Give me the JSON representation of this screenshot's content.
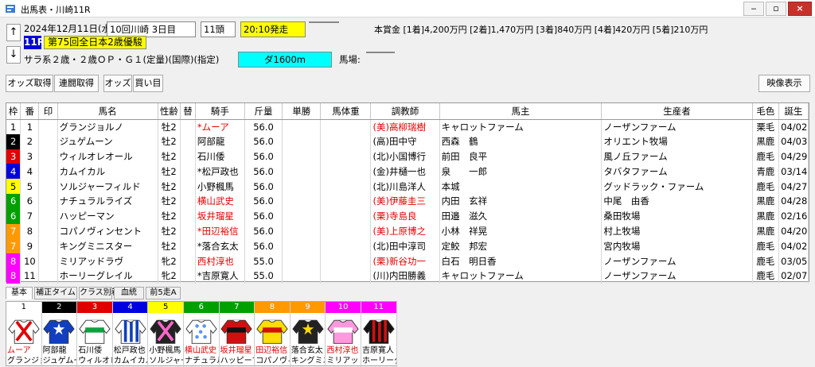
{
  "window": {
    "title": "出馬表・川崎11R"
  },
  "header": {
    "date": "2024年12月11日(水)",
    "meeting": "10回川崎 3日目",
    "runners": "11頭",
    "post_time": "20:10発走",
    "race_no": "11R",
    "race_name": "第75回全日本2歳優駿",
    "conditions": "サラ系２歳・２歳ＯＰ・Ｇ１(定量)(国際)(指定)",
    "distance": "ダ1600m",
    "track_label": "馬場:",
    "prize": "本賞金 [1着]4,200万円 [2着]1,470万円 [3着]840万円 [4着]420万円 [5着]210万円"
  },
  "toolbar": {
    "odds": "オッズ取得",
    "renpuku": "連闘取得",
    "odds2": "オッズ",
    "buy": "買い目",
    "video": "映像表示"
  },
  "table": {
    "columns": [
      "枠",
      "番",
      "印",
      "馬名",
      "性齢",
      "替",
      "騎手",
      "斤量",
      "単勝",
      "馬体重",
      "調教師",
      "馬主",
      "生産者",
      "毛色",
      "誕生"
    ],
    "rows": [
      {
        "waku": "1",
        "ban": "1",
        "name": "グランジョルノ",
        "sex": "牡2",
        "change": "",
        "jockey": "*ムーア",
        "jockey_red": true,
        "weight": "56.0",
        "trainer": "(美)高柳瑞樹",
        "trainer_red": true,
        "owner": "キャロットファーム",
        "breeder": "ノーザンファーム",
        "color": "栗毛",
        "birth": "04/02"
      },
      {
        "waku": "2",
        "ban": "2",
        "name": "ジュゲムーン",
        "sex": "牡2",
        "change": "",
        "jockey": "阿部龍",
        "jockey_red": false,
        "weight": "56.0",
        "trainer": "(高)田中守",
        "trainer_red": false,
        "owner": "西森　鶴",
        "breeder": "オリエント牧場",
        "color": "黒鹿",
        "birth": "04/03"
      },
      {
        "waku": "3",
        "ban": "3",
        "name": "ウィルオレオール",
        "sex": "牡2",
        "change": "",
        "jockey": "石川倭",
        "jockey_red": false,
        "weight": "56.0",
        "trainer": "(北)小国博行",
        "trainer_red": false,
        "owner": "前田　良平",
        "breeder": "風ノ丘ファーム",
        "color": "鹿毛",
        "birth": "04/29"
      },
      {
        "waku": "4",
        "ban": "4",
        "name": "カムイカル",
        "sex": "牡2",
        "change": "",
        "jockey": "*松戸政也",
        "jockey_red": false,
        "weight": "56.0",
        "trainer": "(金)井樋一也",
        "trainer_red": false,
        "owner": "泉　　一郎",
        "breeder": "タバタファーム",
        "color": "青鹿",
        "birth": "03/14"
      },
      {
        "waku": "5",
        "ban": "5",
        "name": "ソルジャーフィルド",
        "sex": "牡2",
        "change": "",
        "jockey": "小野楓馬",
        "jockey_red": false,
        "weight": "56.0",
        "trainer": "(北)川島洋人",
        "trainer_red": false,
        "owner": "本城",
        "breeder": "グッドラック・ファーム",
        "color": "鹿毛",
        "birth": "04/27"
      },
      {
        "waku": "6",
        "ban": "6",
        "name": "ナチュラルライズ",
        "sex": "牡2",
        "change": "",
        "jockey": "横山武史",
        "jockey_red": true,
        "weight": "56.0",
        "trainer": "(美)伊藤圭三",
        "trainer_red": true,
        "owner": "内田　玄祥",
        "breeder": "中尾　由香",
        "color": "黒鹿",
        "birth": "04/28"
      },
      {
        "waku": "6",
        "ban": "7",
        "name": "ハッピーマン",
        "sex": "牡2",
        "change": "",
        "jockey": "坂井瑠星",
        "jockey_red": true,
        "weight": "56.0",
        "trainer": "(栗)寺島良",
        "trainer_red": true,
        "owner": "田邉　滋久",
        "breeder": "桑田牧場",
        "color": "黒鹿",
        "birth": "02/16"
      },
      {
        "waku": "7",
        "ban": "8",
        "name": "コパノヴィンセント",
        "sex": "牡2",
        "change": "",
        "jockey": "*田辺裕信",
        "jockey_red": true,
        "weight": "56.0",
        "trainer": "(美)上原博之",
        "trainer_red": true,
        "owner": "小林　祥晃",
        "breeder": "村上牧場",
        "color": "黒鹿",
        "birth": "04/20"
      },
      {
        "waku": "7",
        "ban": "9",
        "name": "キングミニスター",
        "sex": "牡2",
        "change": "",
        "jockey": "*落合玄太",
        "jockey_red": false,
        "weight": "56.0",
        "trainer": "(北)田中淳司",
        "trainer_red": false,
        "owner": "定鮫　邦宏",
        "breeder": "宮内牧場",
        "color": "鹿毛",
        "birth": "04/02"
      },
      {
        "waku": "8",
        "ban": "10",
        "name": "ミリアッドラヴ",
        "sex": "牝2",
        "change": "",
        "jockey": "西村淳也",
        "jockey_red": true,
        "weight": "55.0",
        "trainer": "(栗)新谷功一",
        "trainer_red": true,
        "owner": "白石　明日香",
        "breeder": "ノーザンファーム",
        "color": "鹿毛",
        "birth": "03/05"
      },
      {
        "waku": "8",
        "ban": "11",
        "name": "ホーリーグレイル",
        "sex": "牝2",
        "change": "",
        "jockey": "*吉原寛人",
        "jockey_red": false,
        "weight": "55.0",
        "trainer": "(川)内田勝義",
        "trainer_red": false,
        "owner": "キャロットファーム",
        "breeder": "ノーザンファーム",
        "color": "鹿毛",
        "birth": "02/07"
      }
    ]
  },
  "tabs": [
    "基本",
    "補正タイム",
    "クラス別着",
    "血統",
    "前5走A"
  ],
  "silks": [
    {
      "num": "1",
      "jockey": "ムーア",
      "jockey_red": true,
      "horse": "グランジョルノ",
      "icon": "silk-red-white-x",
      "hdr_bg": "#ffffff",
      "hdr_fg": "#000000"
    },
    {
      "num": "2",
      "jockey": "阿部龍",
      "jockey_red": false,
      "horse": "ジュゲムーン",
      "icon": "silk-blue-white-stars",
      "hdr_bg": "#000000",
      "hdr_fg": "#ffffff"
    },
    {
      "num": "3",
      "jockey": "石川倭",
      "jockey_red": false,
      "horse": "ウィルオレオール",
      "icon": "silk-white-green",
      "hdr_bg": "#e00000",
      "hdr_fg": "#ffffff"
    },
    {
      "num": "4",
      "jockey": "松戸政也",
      "jockey_red": false,
      "horse": "カムイカル",
      "icon": "silk-blue-stripes",
      "hdr_bg": "#0000e0",
      "hdr_fg": "#ffffff"
    },
    {
      "num": "5",
      "jockey": "小野楓馬",
      "jockey_red": false,
      "horse": "ソルジャーフィルド",
      "icon": "silk-black-pink",
      "hdr_bg": "#ffff00",
      "hdr_fg": "#000000"
    },
    {
      "num": "6",
      "jockey": "横山武史",
      "jockey_red": true,
      "horse": "ナチュラルライズ",
      "icon": "silk-white-blue-dots",
      "hdr_bg": "#00a000",
      "hdr_fg": "#ffffff"
    },
    {
      "num": "7",
      "jockey": "坂井瑠星",
      "jockey_red": true,
      "horse": "ハッピーマン",
      "icon": "silk-red-black",
      "hdr_bg": "#00a000",
      "hdr_fg": "#ffffff"
    },
    {
      "num": "8",
      "jockey": "田辺裕信",
      "jockey_red": true,
      "horse": "コパノヴィンセント",
      "icon": "silk-yellow-red",
      "hdr_bg": "#ff9900",
      "hdr_fg": "#ffffff"
    },
    {
      "num": "9",
      "jockey": "落合玄太",
      "jockey_red": false,
      "horse": "キングミニスター",
      "icon": "silk-black-yellow",
      "hdr_bg": "#ff9900",
      "hdr_fg": "#ffffff"
    },
    {
      "num": "10",
      "jockey": "西村淳也",
      "jockey_red": true,
      "horse": "ミリアッドラヴ",
      "icon": "silk-pink-white",
      "hdr_bg": "#ff00ff",
      "hdr_fg": "#ffffff"
    },
    {
      "num": "11",
      "jockey": "吉原寛人",
      "jockey_red": false,
      "horse": "ホーリーグレイル",
      "icon": "silk-black-red-stripes",
      "hdr_bg": "#ff00ff",
      "hdr_fg": "#ffffff"
    }
  ],
  "waku_colors": {
    "1": [
      "#ffffff",
      "#000000"
    ],
    "2": [
      "#000000",
      "#ffffff"
    ],
    "3": [
      "#e00000",
      "#ffffff"
    ],
    "4": [
      "#0000e0",
      "#ffffff"
    ],
    "5": [
      "#ffff00",
      "#000000"
    ],
    "6": [
      "#00a000",
      "#ffffff"
    ],
    "7": [
      "#ff9900",
      "#ffffff"
    ],
    "8": [
      "#ff00ff",
      "#ffffff"
    ]
  }
}
